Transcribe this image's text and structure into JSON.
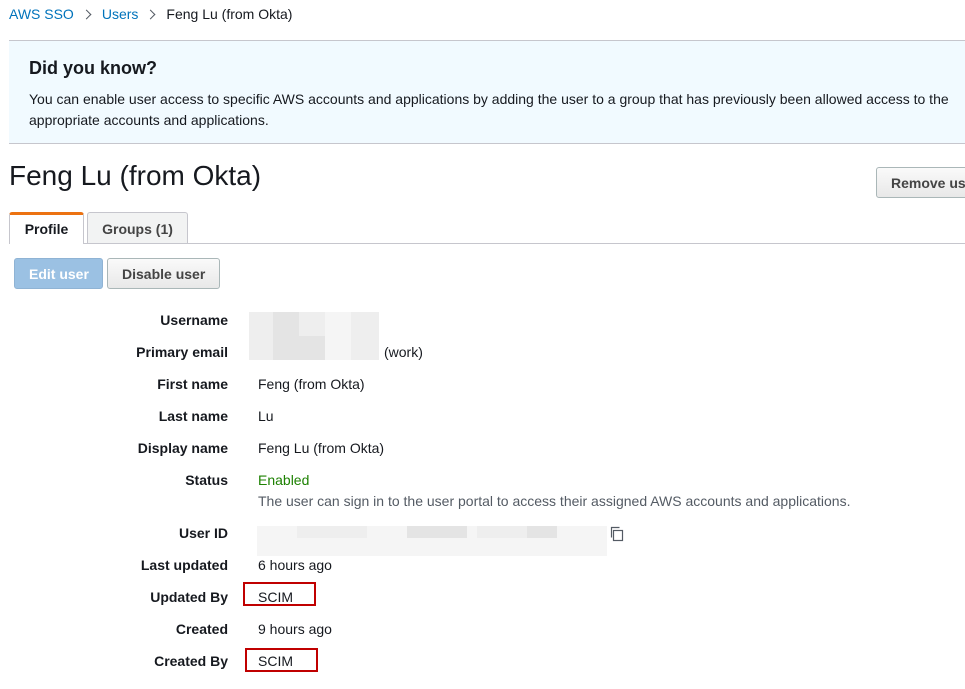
{
  "breadcrumb": {
    "root": "AWS SSO",
    "users": "Users",
    "current": "Feng Lu (from Okta)"
  },
  "info": {
    "title": "Did you know?",
    "text": "You can enable user access to specific AWS accounts and applications by adding the user to a group that has previously been allowed access to the appropriate accounts and applications."
  },
  "page": {
    "title": "Feng Lu (from Okta)",
    "remove_label": "Remove us"
  },
  "tabs": [
    {
      "label": "Profile",
      "active": true
    },
    {
      "label": "Groups (1)",
      "active": false
    }
  ],
  "actions": {
    "edit_label": "Edit user",
    "disable_label": "Disable user"
  },
  "details": {
    "username": {
      "label": "Username",
      "value": ""
    },
    "primary_email": {
      "label": "Primary email",
      "value": "(work)"
    },
    "first_name": {
      "label": "First name",
      "value": "Feng (from Okta)"
    },
    "last_name": {
      "label": "Last name",
      "value": "Lu"
    },
    "display_name": {
      "label": "Display name",
      "value": "Feng Lu (from Okta)"
    },
    "status": {
      "label": "Status",
      "value": "Enabled",
      "description": "The user can sign in to the user portal to access their assigned AWS accounts and applications."
    },
    "user_id": {
      "label": "User ID",
      "value": ""
    },
    "last_updated": {
      "label": "Last updated",
      "value": "6 hours ago"
    },
    "updated_by": {
      "label": "Updated By",
      "value": "SCIM"
    },
    "created": {
      "label": "Created",
      "value": "9 hours ago"
    },
    "created_by": {
      "label": "Created By",
      "value": "SCIM"
    }
  },
  "colors": {
    "link": "#0073bb",
    "status_enabled": "#1d8102",
    "tab_accent": "#ec7211",
    "highlight": "#c00000"
  },
  "icons": {
    "copy": "copy-icon"
  }
}
